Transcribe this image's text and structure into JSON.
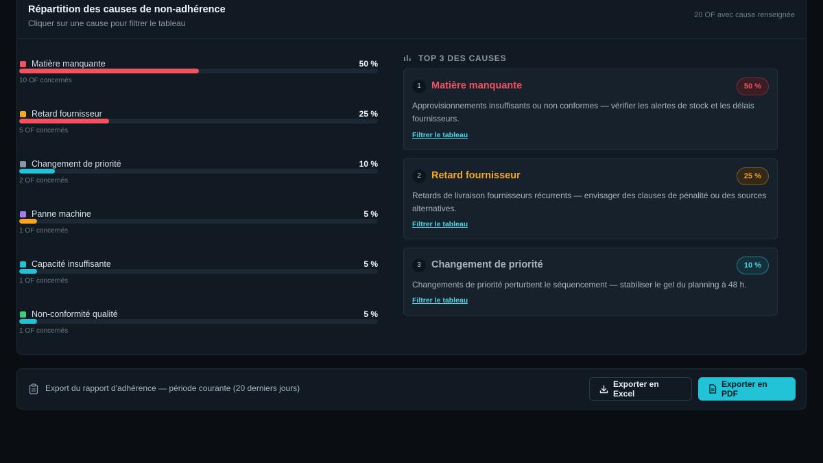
{
  "panel": {
    "title": "Répartition des causes de non-adhérence",
    "subtitle": "Cliquer sur une cause pour filtrer le tableau",
    "meta": "20 OF avec cause renseignée"
  },
  "causes": [
    {
      "label": "Matière manquante",
      "pct_label": "50 %",
      "pct": 50,
      "count_label": "10 OF concernés",
      "swatch": "#f0525e",
      "bar": "#f0525e"
    },
    {
      "label": "Retard fournisseur",
      "pct_label": "25 %",
      "pct": 25,
      "count_label": "5 OF concernés",
      "swatch": "#f5a524",
      "bar": "#f0525e"
    },
    {
      "label": "Changement de priorité",
      "pct_label": "10 %",
      "pct": 10,
      "count_label": "2 OF concernés",
      "swatch": "#8a97a6",
      "bar": "#22c3d6"
    },
    {
      "label": "Panne machine",
      "pct_label": "5 %",
      "pct": 5,
      "count_label": "1 OF concernés",
      "swatch": "#a77cf2",
      "bar": "#f5a524"
    },
    {
      "label": "Capacité insuffisante",
      "pct_label": "5 %",
      "pct": 5,
      "count_label": "1 OF concernés",
      "swatch": "#22c3d6",
      "bar": "#22c3d6"
    },
    {
      "label": "Non-conformité qualité",
      "pct_label": "5 %",
      "pct": 5,
      "count_label": "1 OF concernés",
      "swatch": "#3ecf7e",
      "bar": "#22c3d6"
    }
  ],
  "top3": {
    "title": "TOP 3 DES CAUSES",
    "icon": "bar-chart-icon",
    "cards": [
      {
        "rank": "1",
        "name": "Matière manquante",
        "badge": "50 %",
        "color": "#f0525e",
        "badge_bg": "#3a1d24",
        "badge_border": "#7a2b35",
        "desc": "Approvisionnements insuffisants ou non conformes — vérifier les alertes de stock et les délais fournisseurs.",
        "link": "Filtrer le tableau"
      },
      {
        "rank": "2",
        "name": "Retard fournisseur",
        "badge": "25 %",
        "color": "#f5a524",
        "badge_bg": "#33291a",
        "badge_border": "#7a5a1e",
        "desc": "Retards de livraison fournisseurs récurrents — envisager des clauses de pénalité ou des sources alternatives.",
        "link": "Filtrer le tableau"
      },
      {
        "rank": "3",
        "name": "Changement de priorité",
        "badge": "10 %",
        "color": "#a9b4c0",
        "badge_bg": "#14303a",
        "badge_border": "#1f7f8e",
        "badge_text": "#4fd6e8",
        "desc": "Changements de priorité perturbent le séquencement — stabiliser le gel du planning à 48 h.",
        "link": "Filtrer le tableau"
      }
    ]
  },
  "footer": {
    "text": "Export du rapport d'adhérence — période courante (20 derniers jours)",
    "icon": "clipboard-icon",
    "excel_label": "Exporter en Excel",
    "pdf_label": "Exporter en PDF"
  }
}
